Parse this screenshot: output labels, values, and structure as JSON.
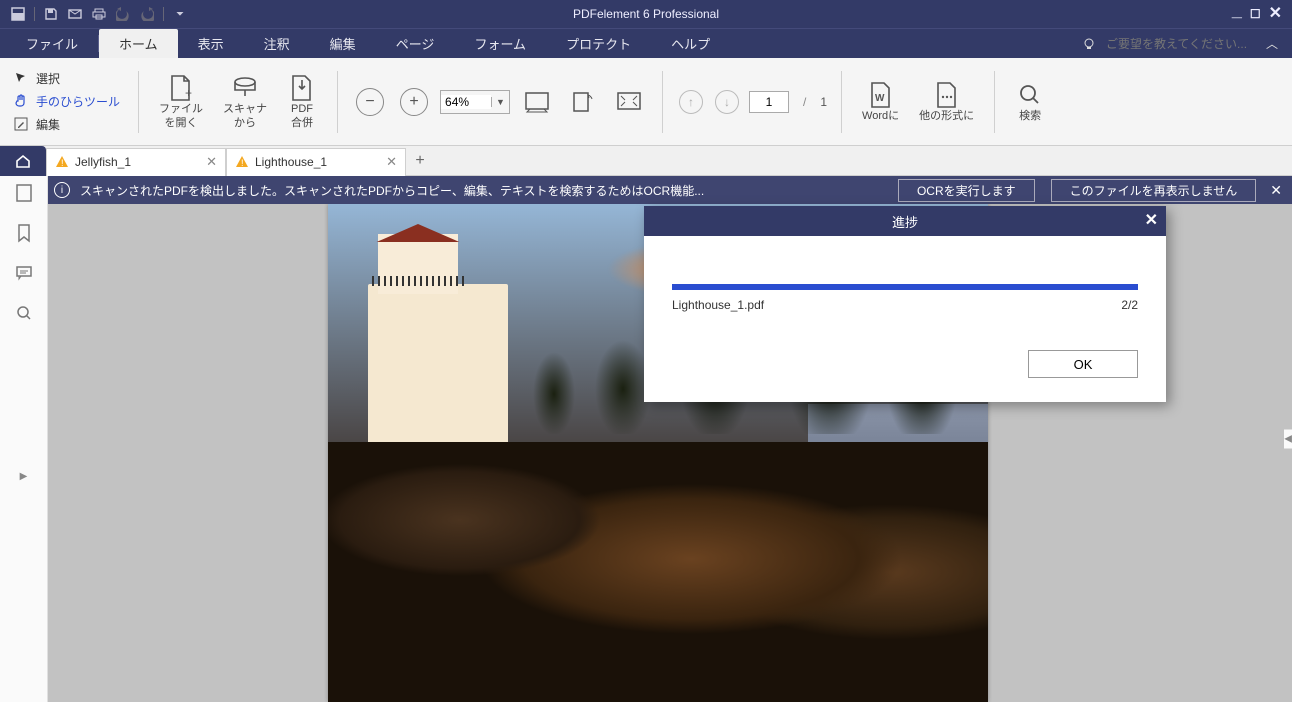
{
  "titlebar": {
    "app_title": "PDFelement 6 Professional"
  },
  "menubar": {
    "items": [
      "ファイル",
      "ホーム",
      "表示",
      "注釈",
      "編集",
      "ページ",
      "フォーム",
      "プロテクト",
      "ヘルプ"
    ],
    "search_placeholder": "ご要望を教えてください..."
  },
  "ribbon": {
    "select": "選択",
    "hand": "手のひらツール",
    "edit": "編集",
    "open_file": "ファイル\nを開く",
    "from_scanner": "スキャナ\nから",
    "combine": "PDF\n合併",
    "zoom_value": "64%",
    "page_current": "1",
    "page_total": "1",
    "to_word": "Wordに",
    "to_other": "他の形式に",
    "search": "検索"
  },
  "tabs": [
    {
      "label": "Jellyfish_1"
    },
    {
      "label": "Lighthouse_1"
    }
  ],
  "ocr_bar": {
    "message": "スキャンされたPDFを検出しました。スキャンされたPDFからコピー、編集、テキストを検索するためはOCR機能...",
    "run_ocr": "OCRを実行します",
    "dont_show": "このファイルを再表示しません"
  },
  "modal": {
    "title": "進捗",
    "filename": "Lighthouse_1.pdf",
    "count": "2/2",
    "ok": "OK"
  }
}
